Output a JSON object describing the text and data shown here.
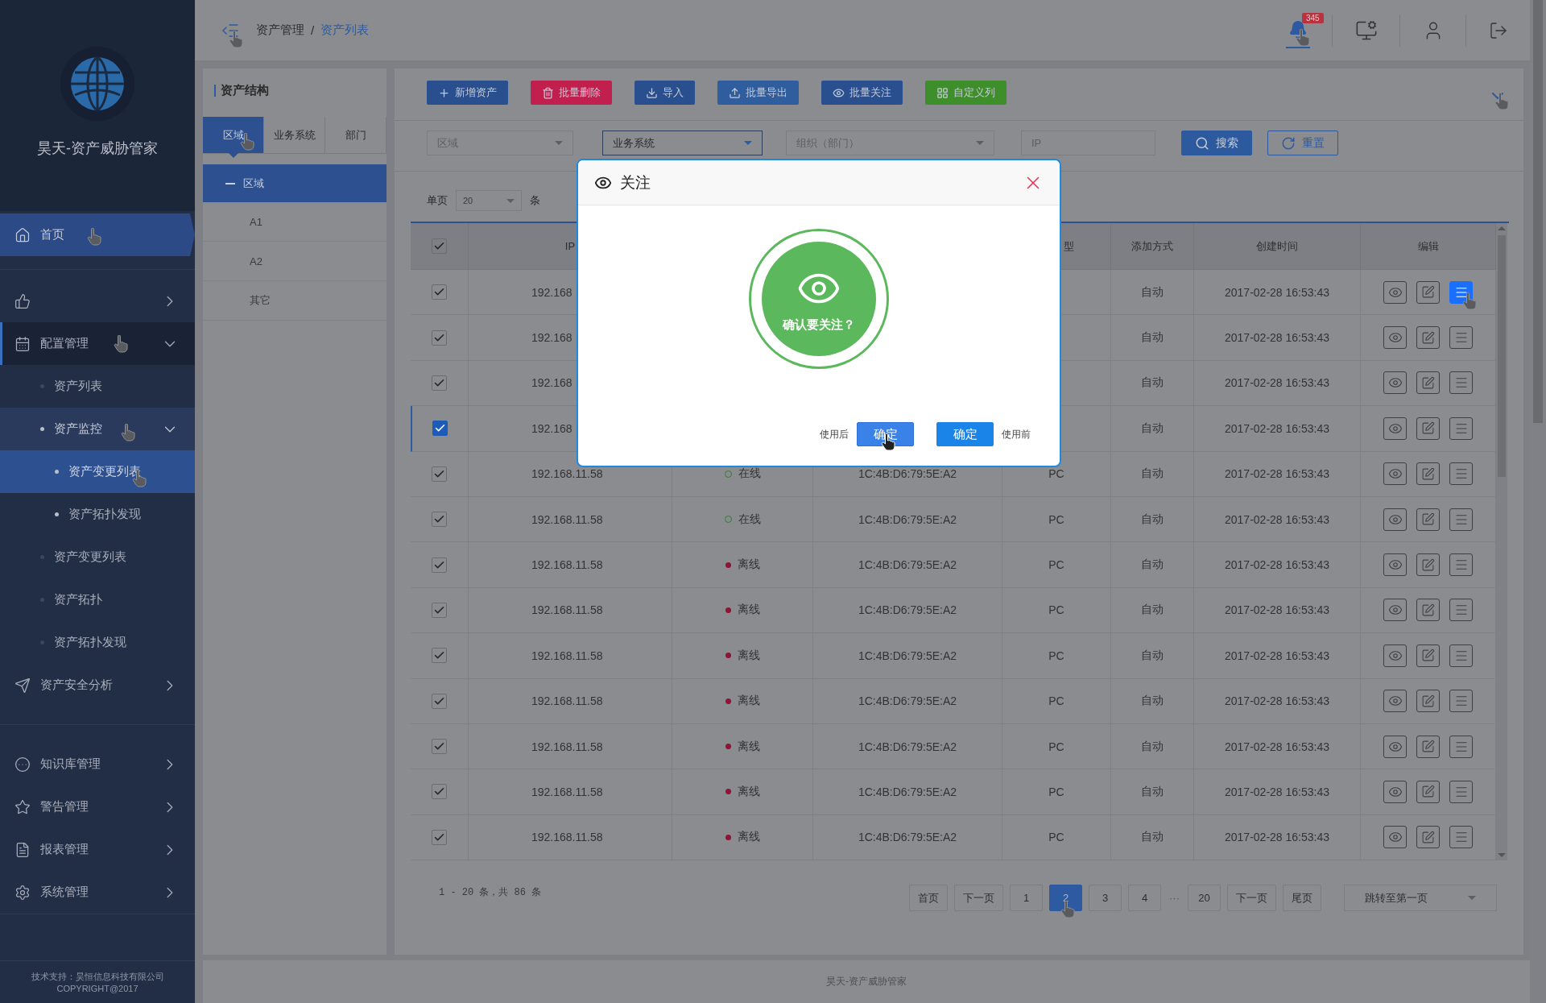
{
  "sidebar": {
    "brand": "昊天-资产威胁管家",
    "groups": [
      [
        {
          "label": "首页",
          "selected": true
        }
      ],
      [
        {
          "selected": false,
          "expanded": false
        },
        {
          "label": "配置管理",
          "selected": false,
          "expanded": true,
          "children": [
            {
              "label": "资产列表",
              "selected": false
            },
            {
              "label": "资产监控",
              "selected": false,
              "expanded": true,
              "children": [
                {
                  "label": "资产变更列表",
                  "selected": true
                },
                {
                  "label": "资产拓扑发现",
                  "selected": false
                }
              ]
            },
            {
              "label": "资产变更列表",
              "selected": false
            },
            {
              "label": "资产拓扑",
              "selected": false
            },
            {
              "label": "资产拓扑发现",
              "selected": false
            }
          ]
        },
        {
          "label": "资产安全分析",
          "selected": false,
          "expanded": false
        }
      ],
      [
        {
          "label": "知识库管理",
          "selected": false,
          "expanded": false
        },
        {
          "label": "警告管理",
          "selected": false,
          "expanded": false
        },
        {
          "label": "报表管理",
          "selected": false,
          "expanded": false
        },
        {
          "label": "系统管理",
          "selected": false,
          "expanded": false
        }
      ]
    ],
    "footer": [
      "技术支持：昊恒信息科技有限公司",
      "COPYRIGHT@2017"
    ]
  },
  "topbar": {
    "separator": "/",
    "breadcrumb": [
      {
        "label": "资产管理",
        "selected": false
      },
      {
        "label": "资产列表",
        "selected": true
      }
    ],
    "notification_count": "345"
  },
  "structure": {
    "title": "资产结构",
    "tabs": [
      {
        "label": "区域",
        "selected": true
      },
      {
        "label": "业务系统",
        "selected": false
      },
      {
        "label": "部门",
        "selected": false
      }
    ],
    "tree": [
      {
        "label": "区域",
        "expanded": true,
        "selected": true,
        "children": [
          {
            "label": "A1",
            "selected": false
          },
          {
            "label": "A2",
            "selected": false
          },
          {
            "label": "其它",
            "selected": false
          }
        ]
      }
    ]
  },
  "toolbar": [
    {
      "label": "新增资产",
      "color": "#2a4f8e"
    },
    {
      "label": "批量删除",
      "color": "#c11f4e"
    },
    {
      "label": "导入",
      "color": "#2a4f8e"
    },
    {
      "label": "批量导出",
      "color": "#2f5d9e"
    },
    {
      "label": "批量关注",
      "color": "#2a4f8e"
    },
    {
      "label": "自定义列",
      "color": "#3e8e2b"
    }
  ],
  "filters": {
    "region": {
      "placeholder": "区域"
    },
    "system": {
      "value": "业务系统"
    },
    "org": {
      "placeholder": "组织（部门）"
    },
    "ip": {
      "placeholder": "IP"
    },
    "search": "搜索",
    "reset": "重置"
  },
  "page_size": {
    "label": "单页",
    "value": "20",
    "unit": "条"
  },
  "table": {
    "header_checked": true,
    "columns": [
      "IP",
      "型",
      "添加方式",
      "创建时间",
      "编辑"
    ],
    "rows": [
      {
        "checked": true,
        "selected": false,
        "ip": "192.168",
        "add_method": "自动",
        "created": "2017-02-28 16:53:43",
        "menu_selected": true
      },
      {
        "checked": true,
        "selected": false,
        "ip": "192.168",
        "add_method": "自动",
        "created": "2017-02-28 16:53:43",
        "menu_selected": false
      },
      {
        "checked": true,
        "selected": false,
        "ip": "192.168",
        "add_method": "自动",
        "created": "2017-02-28 16:53:43",
        "menu_selected": false
      },
      {
        "checked": true,
        "selected": true,
        "ip": "192.168",
        "add_method": "自动",
        "created": "2017-02-28 16:53:43",
        "menu_selected": false
      },
      {
        "checked": true,
        "selected": false,
        "ip": "192.168.11.58",
        "status": "在线",
        "online": true,
        "mac": "1C:4B:D6:79:5E:A2",
        "type": "PC",
        "add_method": "自动",
        "created": "2017-02-28 16:53:43",
        "menu_selected": false
      },
      {
        "checked": true,
        "selected": false,
        "ip": "192.168.11.58",
        "status": "在线",
        "online": true,
        "mac": "1C:4B:D6:79:5E:A2",
        "type": "PC",
        "add_method": "自动",
        "created": "2017-02-28 16:53:43",
        "menu_selected": false
      },
      {
        "checked": true,
        "selected": false,
        "ip": "192.168.11.58",
        "status": "离线",
        "online": false,
        "mac": "1C:4B:D6:79:5E:A2",
        "type": "PC",
        "add_method": "自动",
        "created": "2017-02-28 16:53:43",
        "menu_selected": false
      },
      {
        "checked": true,
        "selected": false,
        "ip": "192.168.11.58",
        "status": "离线",
        "online": false,
        "mac": "1C:4B:D6:79:5E:A2",
        "type": "PC",
        "add_method": "自动",
        "created": "2017-02-28 16:53:43",
        "menu_selected": false
      },
      {
        "checked": true,
        "selected": false,
        "ip": "192.168.11.58",
        "status": "离线",
        "online": false,
        "mac": "1C:4B:D6:79:5E:A2",
        "type": "PC",
        "add_method": "自动",
        "created": "2017-02-28 16:53:43",
        "menu_selected": false
      },
      {
        "checked": true,
        "selected": false,
        "ip": "192.168.11.58",
        "status": "离线",
        "online": false,
        "mac": "1C:4B:D6:79:5E:A2",
        "type": "PC",
        "add_method": "自动",
        "created": "2017-02-28 16:53:43",
        "menu_selected": false
      },
      {
        "checked": true,
        "selected": false,
        "ip": "192.168.11.58",
        "status": "离线",
        "online": false,
        "mac": "1C:4B:D6:79:5E:A2",
        "type": "PC",
        "add_method": "自动",
        "created": "2017-02-28 16:53:43",
        "menu_selected": false
      },
      {
        "checked": true,
        "selected": false,
        "ip": "192.168.11.58",
        "status": "离线",
        "online": false,
        "mac": "1C:4B:D6:79:5E:A2",
        "type": "PC",
        "add_method": "自动",
        "created": "2017-02-28 16:53:43",
        "menu_selected": false
      },
      {
        "checked": true,
        "selected": false,
        "ip": "192.168.11.58",
        "status": "离线",
        "online": false,
        "mac": "1C:4B:D6:79:5E:A2",
        "type": "PC",
        "add_method": "自动",
        "created": "2017-02-28 16:53:43",
        "menu_selected": false
      }
    ]
  },
  "pagination": {
    "summary": "1 - 20 条，共 86 条",
    "pages": [
      {
        "label": "首页",
        "selected": false
      },
      {
        "label": "下一页",
        "selected": false
      },
      {
        "label": "1",
        "selected": false
      },
      {
        "label": "2",
        "selected": true
      },
      {
        "label": "3",
        "selected": false
      },
      {
        "label": "4",
        "selected": false
      },
      {
        "kind": "ellipsis",
        "label": "···"
      },
      {
        "label": "20",
        "selected": false
      },
      {
        "label": "下一页",
        "selected": false
      },
      {
        "label": "尾页",
        "selected": false
      }
    ],
    "jump": "跳转至第一页"
  },
  "footer": "昊天-资产威胁管家",
  "modal": {
    "title": "关注",
    "message": "确认要关注？",
    "left_caption": "使用后",
    "left_button": "确定",
    "right_button": "确定",
    "right_caption": "使用前"
  }
}
